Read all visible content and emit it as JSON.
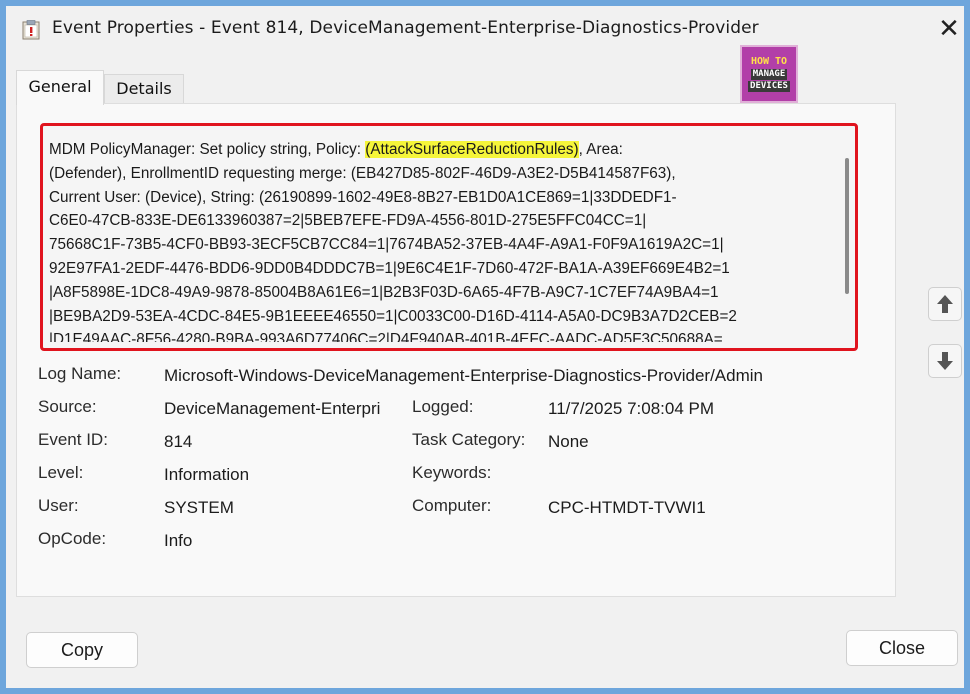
{
  "window": {
    "title": "Event Properties - Event 814, DeviceManagement-Enterprise-Diagnostics-Provider",
    "close_glyph": "✕"
  },
  "tabs": [
    {
      "label": "General",
      "active": true
    },
    {
      "label": "Details",
      "active": false
    }
  ],
  "logo": {
    "line1": "HOW TO",
    "line2": "MANAGE",
    "line3": "DEVICES"
  },
  "message": {
    "lines": [
      [
        "MDM PolicyManager: Set policy string, Policy: ",
        "(AttackSurfaceReductionRules)",
        ", Area:"
      ],
      [
        "(Defender), EnrollmentID requesting merge: (EB427D85-802F-46D9-A3E2-D5B414587F63),"
      ],
      [
        "Current User: (Device), String: (26190899-1602-49E8-8B27-EB1D0A1CE869=1|33DDEDF1-"
      ],
      [
        "C6E0-47CB-833E-DE6133960387=2|5BEB7EFE-FD9A-4556-801D-275E5FFC04CC=1|"
      ],
      [
        "75668C1F-73B5-4CF0-BB93-3ECF5CB7CC84=1|7674BA52-37EB-4A4F-A9A1-F0F9A1619A2C=1|"
      ],
      [
        "92E97FA1-2EDF-4476-BDD6-9DD0B4DDDC7B=1|9E6C4E1F-7D60-472F-BA1A-A39EF669E4B2=1"
      ],
      [
        "|A8F5898E-1DC8-49A9-9878-85004B8A61E6=1|B2B3F03D-6A65-4F7B-A9C7-1C7EF74A9BA4=1"
      ],
      [
        "|BE9BA2D9-53EA-4CDC-84E5-9B1EEEE46550=1|C0033C00-D16D-4114-A5A0-DC9B3A7D2CEB=2"
      ],
      [
        "|D1E49AAC-8F56-4280-B9BA-993A6D77406C=2|D4F940AB-401B-4EFC-AADC-AD5F3C50688A="
      ]
    ]
  },
  "details": {
    "log_name": {
      "label": "Log Name:",
      "value": "Microsoft-Windows-DeviceManagement-Enterprise-Diagnostics-Provider/Admin"
    },
    "source": {
      "label": "Source:",
      "value": "DeviceManagement-Enterpri"
    },
    "logged": {
      "label": "Logged:",
      "value": "11/7/2025 7:08:04 PM"
    },
    "event_id": {
      "label": "Event ID:",
      "value": "814"
    },
    "task_category": {
      "label": "Task Category:",
      "value": "None"
    },
    "level": {
      "label": "Level:",
      "value": "Information"
    },
    "keywords": {
      "label": "Keywords:",
      "value": ""
    },
    "user": {
      "label": "User:",
      "value": "SYSTEM"
    },
    "computer": {
      "label": "Computer:",
      "value": "CPC-HTMDT-TVWI1"
    },
    "opcode": {
      "label": "OpCode:",
      "value": "Info"
    }
  },
  "buttons": {
    "copy": "Copy",
    "close": "Close"
  },
  "colors": {
    "highlight_border": "#e0141e",
    "highlight_text": "#f5f53a",
    "logo_bg": "#b23fa8"
  }
}
